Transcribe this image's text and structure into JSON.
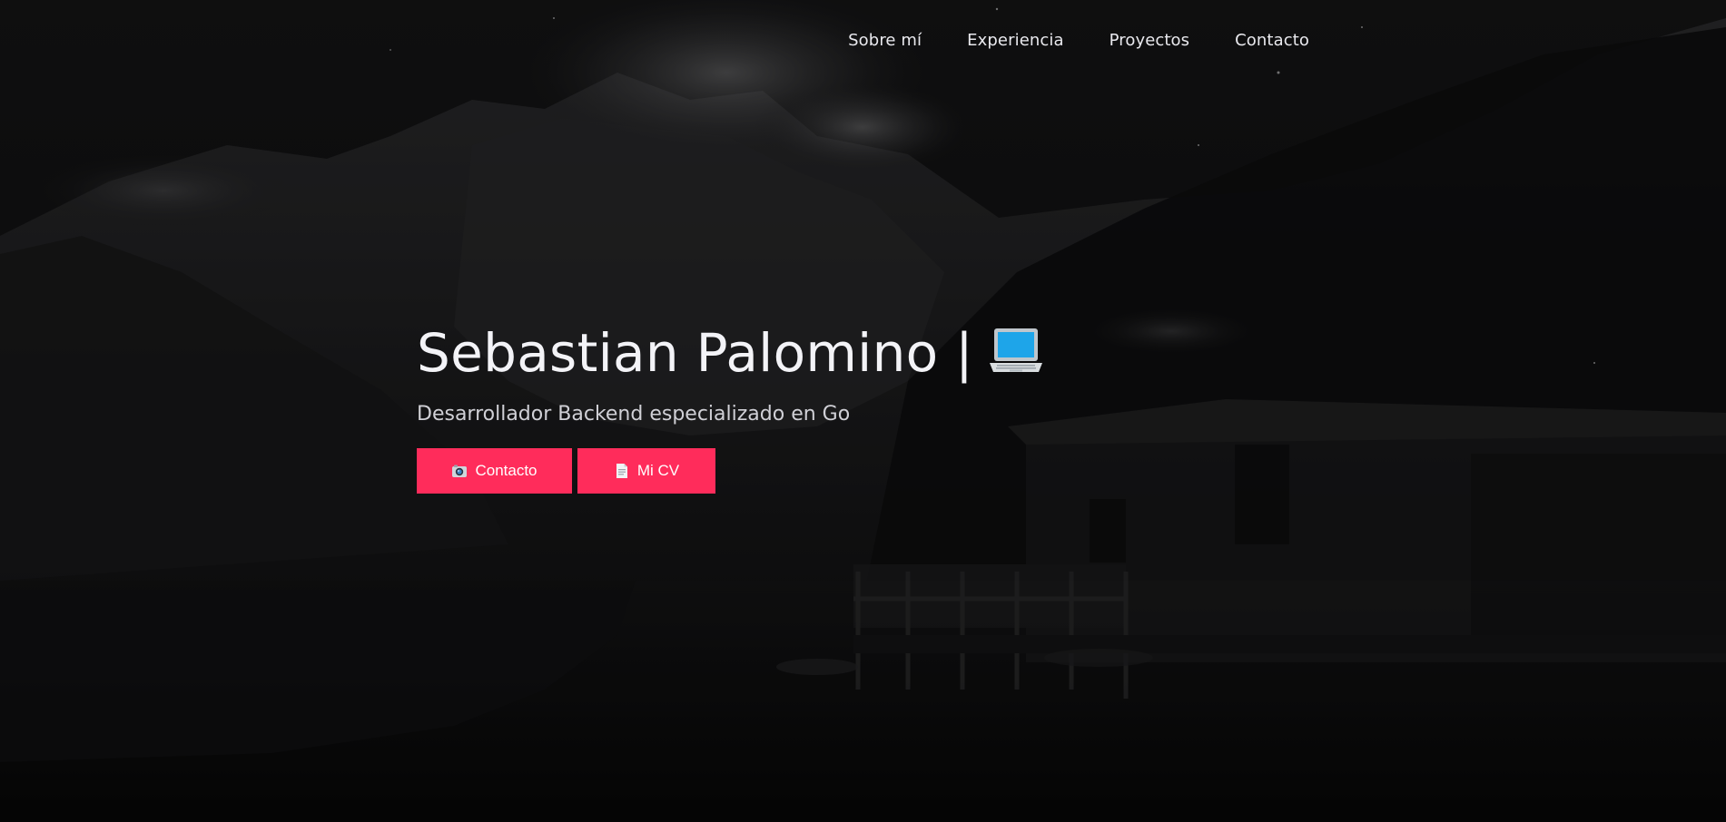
{
  "page": {
    "accent": "#ff2c5b",
    "background": "#0a0a0b"
  },
  "nav": {
    "items": [
      {
        "label": "Sobre mí"
      },
      {
        "label": "Experiencia"
      },
      {
        "label": "Proyectos"
      },
      {
        "label": "Contacto"
      }
    ]
  },
  "hero": {
    "title": "Sebastian Palomino |",
    "title_icon": "laptop-icon",
    "subtitle": "Desarrollador Backend especializado en Go",
    "buttons": [
      {
        "label": "Contacto",
        "icon": "camera-icon"
      },
      {
        "label": "Mi CV",
        "icon": "document-icon"
      }
    ]
  }
}
